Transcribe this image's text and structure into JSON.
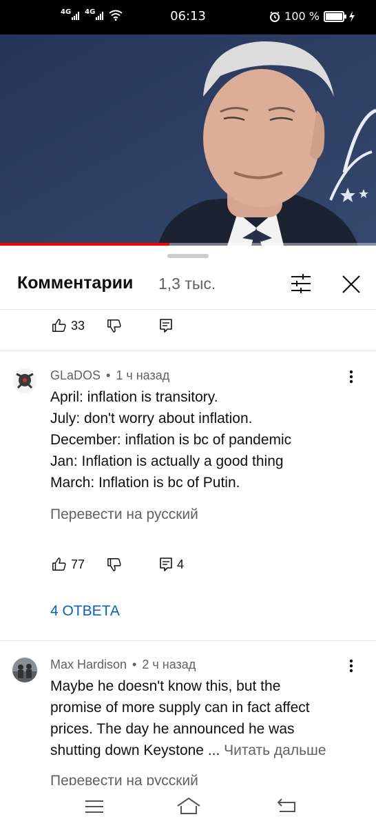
{
  "status_bar": {
    "network_1": "4G",
    "network_2": "4G",
    "time": "06:13",
    "battery": "100 %"
  },
  "video": {
    "progress_fraction": 0.45
  },
  "comments_panel": {
    "title": "Комментарии",
    "count": "1,3 тыс."
  },
  "prev_comment": {
    "likes": "33"
  },
  "comments": [
    {
      "author": "GLaDOS",
      "time": "1 ч назад",
      "lines": [
        "April: inflation is transitory.",
        "July: don't worry about inflation.",
        "December: inflation is bc of pandemic",
        "Jan: Inflation is actually a good thing",
        "March: Inflation is bc of Putin."
      ],
      "translate": "Перевести на русский",
      "likes": "77",
      "replies_count": "4",
      "replies_link": "4 ОТВЕТА"
    },
    {
      "author": "Max Hardison",
      "time": "2 ч назад",
      "lines": [
        "Maybe he doesn't know this, but the",
        "promise of more supply can in fact affect",
        "prices. The day he announced he was",
        "shutting down Keystone ..."
      ],
      "read_more": "Читать дальше",
      "translate": "Перевести на русский"
    }
  ],
  "icons": {
    "like": "thumb-up-icon",
    "dislike": "thumb-down-icon",
    "reply": "reply-icon",
    "more": "more-vert-icon",
    "filter": "sort-filter-icon",
    "close": "close-icon",
    "nav_menu": "menu-icon",
    "nav_home": "home-icon",
    "nav_back": "back-icon"
  },
  "colors": {
    "accent_blue": "#065fd4",
    "progress_red": "#ff0000",
    "secondary_text": "#606060"
  }
}
